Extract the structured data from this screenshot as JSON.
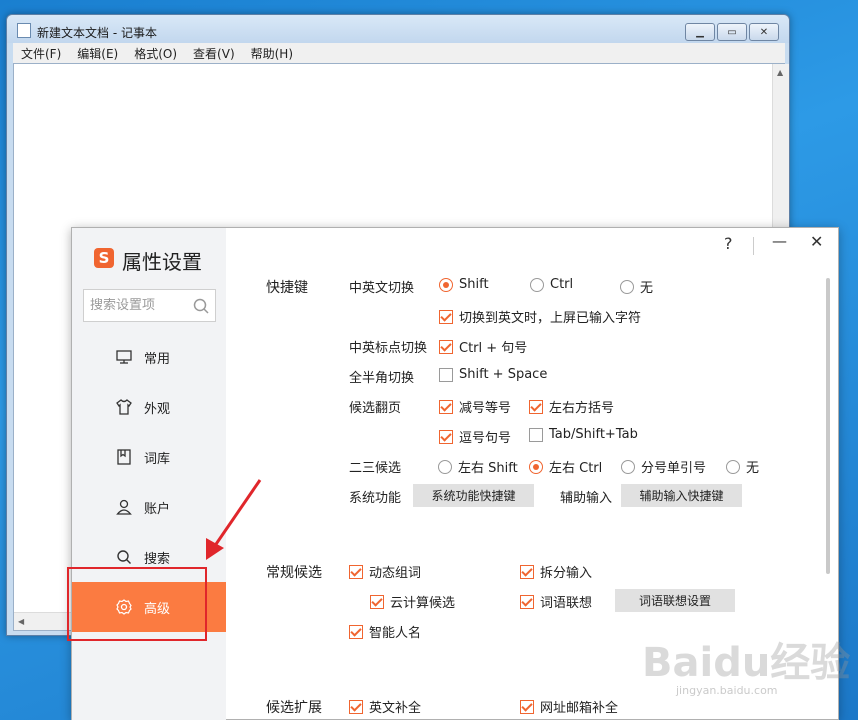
{
  "notepad": {
    "title": "新建文本文档 - 记事本",
    "menu": [
      "文件(F)",
      "编辑(E)",
      "格式(O)",
      "查看(V)",
      "帮助(H)"
    ]
  },
  "dialog": {
    "title": "属性设置",
    "logo_letter": "S",
    "search_placeholder": "搜索设置项",
    "help": "?",
    "nav": [
      "常用",
      "外观",
      "词库",
      "账户",
      "搜索",
      "高级"
    ],
    "active_nav": "高级",
    "shortcut": {
      "section": "快捷键",
      "cn_en_switch": {
        "label": "中英文切换",
        "options": [
          "Shift",
          "Ctrl",
          "无"
        ],
        "selected": "Shift"
      },
      "switch_upload": {
        "label": "切换到英文时，上屏已输入字符",
        "checked": true
      },
      "punct_switch": {
        "label": "中英标点切换",
        "option": "Ctrl + 句号",
        "checked": true
      },
      "width_switch": {
        "label": "全半角切换",
        "option": "Shift + Space",
        "checked": false
      },
      "page_turn": {
        "label": "候选翻页",
        "opt1": "减号等号",
        "opt2": "左右方括号",
        "opt3": "逗号句号",
        "opt4": "Tab/Shift+Tab"
      },
      "second_third": {
        "label": "二三候选",
        "options": [
          "左右 Shift",
          "左右 Ctrl",
          "分号单引号",
          "无"
        ],
        "selected": "左右 Ctrl"
      },
      "system": {
        "label": "系统功能",
        "button": "系统功能快捷键"
      },
      "assist": {
        "label": "辅助输入",
        "button": "辅助输入快捷键"
      }
    },
    "candidates": {
      "section": "常规候选",
      "dynamic": "动态组词",
      "split": "拆分输入",
      "cloud": "云计算候选",
      "association": "词语联想",
      "association_button": "词语联想设置",
      "names": "智能人名"
    },
    "extend": {
      "section": "候选扩展",
      "english": "英文补全",
      "url": "网址邮箱补全"
    }
  },
  "watermark": {
    "text": "Baidu经验",
    "sub": "jingyan.baidu.com"
  },
  "colors": {
    "accent": "#f06530",
    "sidebar_active": "#fb7b41",
    "annotation": "#e0262b"
  }
}
